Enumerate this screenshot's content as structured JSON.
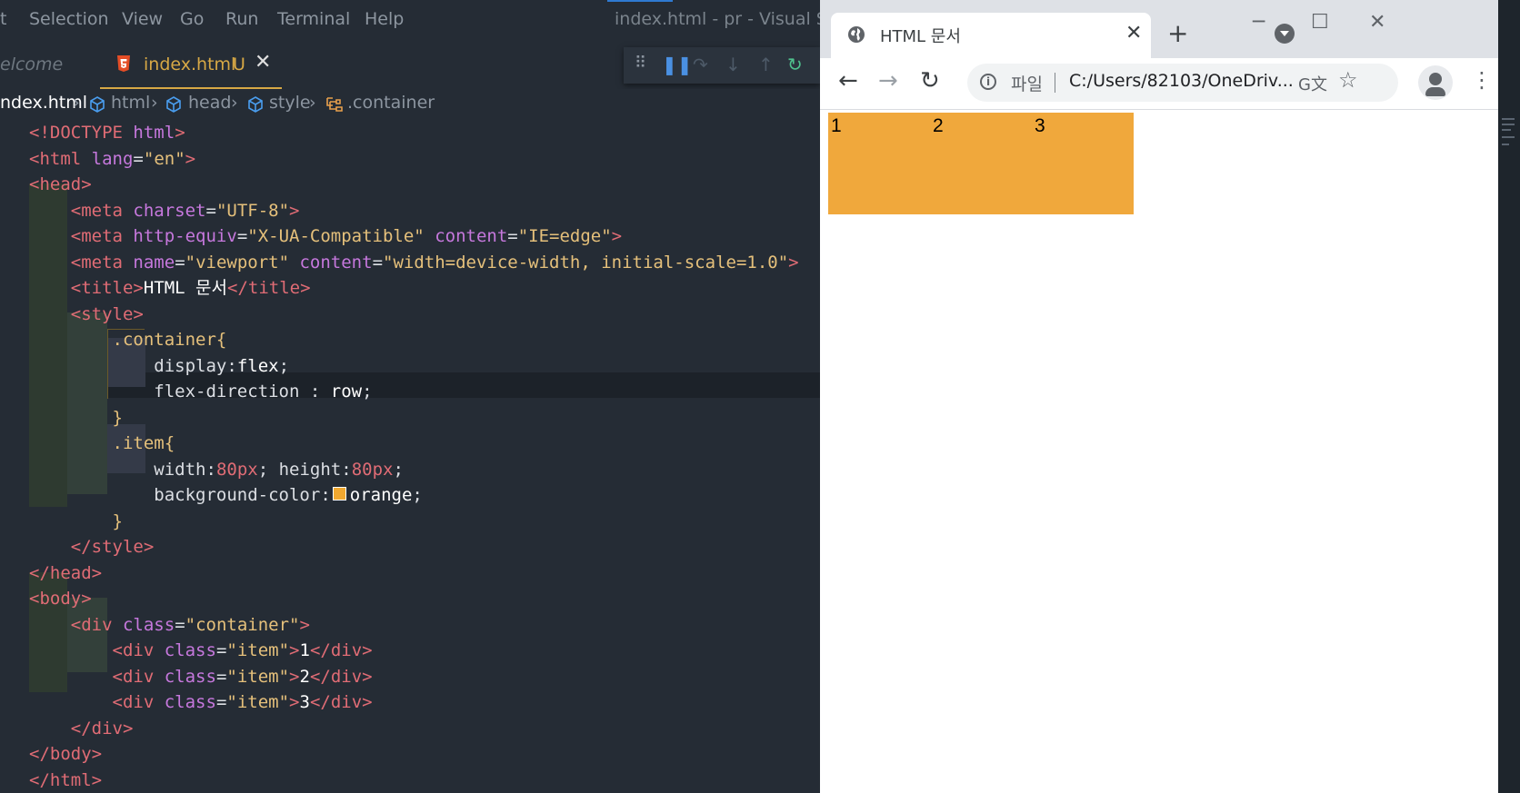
{
  "vscode": {
    "menu": [
      "t",
      "Selection",
      "View",
      "Go",
      "Run",
      "Terminal",
      "Help"
    ],
    "window_title": "index.html - pr - Visual Studi",
    "tabs": {
      "welcome": "elcome",
      "active_file": "index.html",
      "active_status": "U"
    },
    "breadcrumb": {
      "file": "ndex.html",
      "items": [
        "html",
        "head",
        "style",
        ".container"
      ]
    }
  },
  "code_lines": [
    "<!DOCTYPE html>",
    "<html lang=\"en\">",
    "<head>",
    "<meta charset=\"UTF-8\">",
    "<meta http-equiv=\"X-UA-Compatible\" content=\"IE=edge\">",
    "<meta name=\"viewport\" content=\"width=device-width, initial-scale=1.0\">",
    "<title>HTML 문서</title>",
    "<style>",
    ".container{",
    "display:flex;",
    "flex-direction : row;",
    "}",
    ".item{",
    "width:80px; height:80px;",
    "background-color: orange;",
    "}",
    "</style>",
    "</head>",
    "<body>",
    "<div class=\"container\">",
    "<div class=\"item\">1</div>",
    "<div class=\"item\">2</div>",
    "<div class=\"item\">3</div>",
    "</div>",
    "</body>",
    "</html>"
  ],
  "browser": {
    "tab_title": "HTML 문서",
    "address_scheme": "파일",
    "address_url": "C:/Users/82103/OneDriv...",
    "items": [
      "1",
      "2",
      "3"
    ],
    "item_color": "#f0a83c"
  }
}
